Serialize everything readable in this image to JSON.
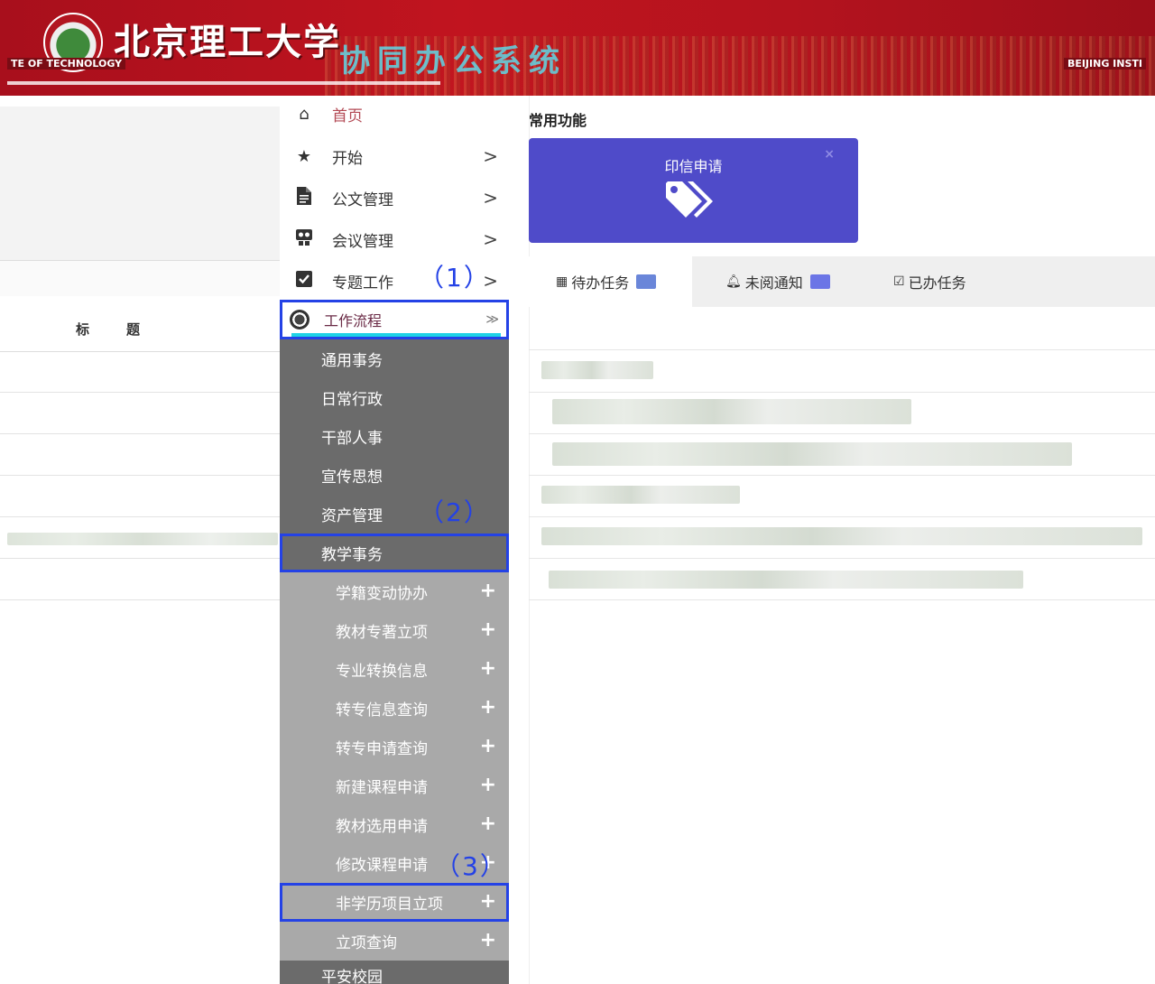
{
  "header": {
    "title_cn": "北京理工大学",
    "system_name": "协同办公系统",
    "en_left": "TE OF TECHNOLOGY",
    "en_right": "BEIJING INSTI",
    "brand_color": "#b3131e"
  },
  "left_table": {
    "columns": [
      "标",
      "题"
    ]
  },
  "menu": {
    "home": {
      "label": "首页",
      "icon": "home-icon"
    },
    "items": [
      {
        "label": "开始",
        "icon": "star-icon",
        "arrow": ">"
      },
      {
        "label": "公文管理",
        "icon": "document-icon",
        "arrow": ">"
      },
      {
        "label": "会议管理",
        "icon": "meeting-icon",
        "arrow": ">"
      },
      {
        "label": "专题工作",
        "icon": "checkbox-icon",
        "arrow": ">"
      }
    ],
    "category": {
      "label": "工作流程",
      "chevron": "≫"
    },
    "sub_items": [
      "通用事务",
      "日常行政",
      "干部人事",
      "宣传思想",
      "资产管理",
      "教学事务"
    ],
    "teaching_items": [
      "学籍变动协办",
      "教材专著立项",
      "专业转换信息",
      "转专信息查询",
      "转专申请查询",
      "新建课程申请",
      "教材选用申请",
      "修改课程申请",
      "非学历项目立项",
      "立项查询"
    ],
    "tail_item": "平安校园",
    "plus": "+"
  },
  "callouts": {
    "c1": "（1）",
    "c2": "（2）",
    "c3": "（3）",
    "color": "#2442e6"
  },
  "right": {
    "section_title": "常用功能",
    "card": {
      "title": "印信申请",
      "close": "×",
      "color": "#4f4bc9"
    },
    "tabs": [
      {
        "label": "待办任务",
        "icon": "calendar-icon"
      },
      {
        "label": "未阅通知",
        "icon": "bell-icon"
      },
      {
        "label": "已办任务",
        "icon": "calendar-check-icon"
      }
    ]
  }
}
